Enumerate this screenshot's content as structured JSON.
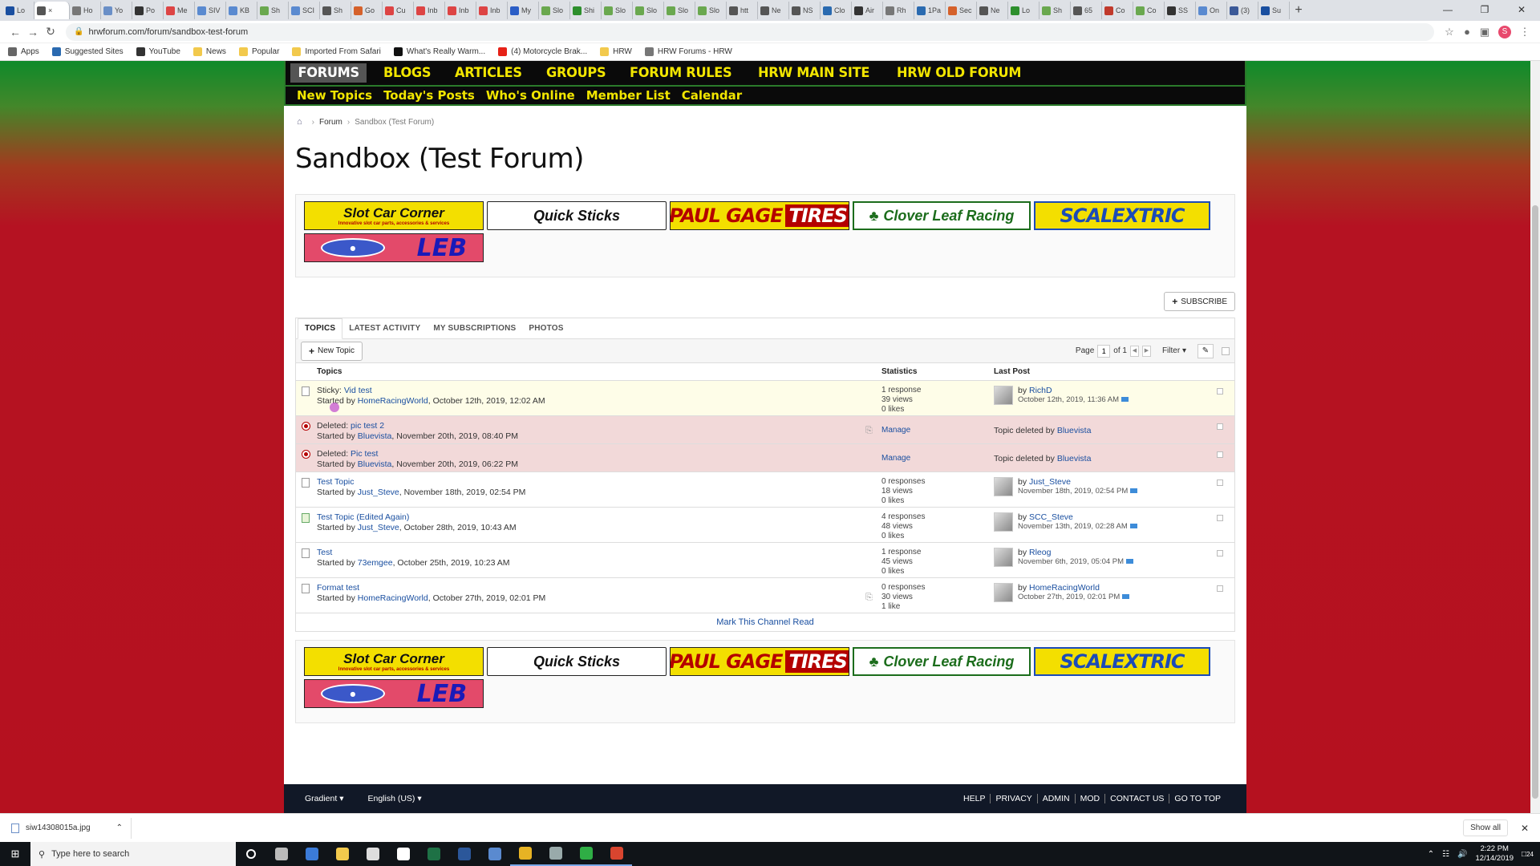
{
  "browser": {
    "tabs": [
      {
        "label": "Lo",
        "color": "#1a4fa0"
      },
      {
        "label": "",
        "color": "#555",
        "active": true
      },
      {
        "label": "Ho",
        "color": "#777"
      },
      {
        "label": "Yo",
        "color": "#6a8fc7"
      },
      {
        "label": "Po",
        "color": "#333"
      },
      {
        "label": "Me",
        "color": "#d44"
      },
      {
        "label": "SIV",
        "color": "#5a8ad0"
      },
      {
        "label": "KB",
        "color": "#5a8ad0"
      },
      {
        "label": "Sh",
        "color": "#6aa84f"
      },
      {
        "label": "SCI",
        "color": "#5a8ad0"
      },
      {
        "label": "Sh",
        "color": "#555"
      },
      {
        "label": "Go",
        "color": "#d5612b"
      },
      {
        "label": "Cu",
        "color": "#d44"
      },
      {
        "label": "Inb",
        "color": "#d44"
      },
      {
        "label": "Inb",
        "color": "#d44"
      },
      {
        "label": "Inb",
        "color": "#d44"
      },
      {
        "label": "My",
        "color": "#2a5dc6"
      },
      {
        "label": "Slo",
        "color": "#6aa84f"
      },
      {
        "label": "Shi",
        "color": "#2d8f2d"
      },
      {
        "label": "Slo",
        "color": "#6aa84f"
      },
      {
        "label": "Slo",
        "color": "#6aa84f"
      },
      {
        "label": "Slo",
        "color": "#6aa84f"
      },
      {
        "label": "Slo",
        "color": "#6aa84f"
      },
      {
        "label": "htt",
        "color": "#555"
      },
      {
        "label": "Ne",
        "color": "#555"
      },
      {
        "label": "NS",
        "color": "#555"
      },
      {
        "label": "Clo",
        "color": "#2a6ab0"
      },
      {
        "label": "Air",
        "color": "#333"
      },
      {
        "label": "Rh",
        "color": "#777"
      },
      {
        "label": "1Pa",
        "color": "#2a6ab0"
      },
      {
        "label": "Sec",
        "color": "#d5612b"
      },
      {
        "label": "Ne",
        "color": "#555"
      },
      {
        "label": "Lo",
        "color": "#2d8f2d"
      },
      {
        "label": "Sh",
        "color": "#6aa84f"
      },
      {
        "label": "65",
        "color": "#555"
      },
      {
        "label": "Co",
        "color": "#c0392b"
      },
      {
        "label": "Co",
        "color": "#6aa84f"
      },
      {
        "label": "SS",
        "color": "#333"
      },
      {
        "label": "On",
        "color": "#5a8ad0"
      },
      {
        "label": "(3)",
        "color": "#3b5998"
      },
      {
        "label": "Su",
        "color": "#1a4fa0"
      }
    ],
    "url": "hrwforum.com/forum/sandbox-test-forum",
    "bookmarks": [
      {
        "label": "Apps",
        "color": "#666"
      },
      {
        "label": "Suggested Sites",
        "color": "#2a6ab0"
      },
      {
        "label": "YouTube",
        "color": "#333"
      },
      {
        "label": "News",
        "color": "#f2c94c"
      },
      {
        "label": "Popular",
        "color": "#f2c94c"
      },
      {
        "label": "Imported From Safari",
        "color": "#f2c94c"
      },
      {
        "label": "What's Really Warm...",
        "color": "#111"
      },
      {
        "label": "(4) Motorcycle Brak...",
        "color": "#e62117"
      },
      {
        "label": "HRW",
        "color": "#f2c94c"
      },
      {
        "label": "HRW Forums - HRW",
        "color": "#777"
      }
    ]
  },
  "nav": {
    "main": [
      "FORUMS",
      "BLOGS",
      "ARTICLES",
      "GROUPS",
      "FORUM RULES",
      "HRW MAIN SITE",
      "HRW OLD FORUM"
    ],
    "sub": [
      "New Topics",
      "Today's Posts",
      "Who's Online",
      "Member List",
      "Calendar"
    ]
  },
  "breadcrumb": {
    "forum": "Forum",
    "current": "Sandbox (Test Forum)"
  },
  "page_title": "Sandbox (Test Forum)",
  "sponsors": {
    "slot_car": "Slot Car Corner",
    "slot_car_tag": "Innovative slot car parts, accessories & services",
    "quick_sticks": "Quick Sticks",
    "paul_gage": "PAUL GAGE",
    "paul_gage_tires": "TIRES",
    "clover": "Clover Leaf Racing",
    "scalextric": "SCALEXTRIC",
    "leb": "LEB"
  },
  "subscribe_label": "SUBSCRIBE",
  "tabs": [
    "TOPICS",
    "LATEST ACTIVITY",
    "MY SUBSCRIPTIONS",
    "PHOTOS"
  ],
  "new_topic_label": "New Topic",
  "pager": {
    "page_label": "Page",
    "page": "1",
    "of_label": "of 1"
  },
  "filter_label": "Filter",
  "columns": {
    "topics": "Topics",
    "statistics": "Statistics",
    "last_post": "Last Post"
  },
  "topics": [
    {
      "kind": "sticky",
      "prefix": "Sticky:",
      "title": "Vid test",
      "started_by": "HomeRacingWorld",
      "started_at": ", October 12th, 2019, 12:02 AM",
      "stats": [
        "1 response",
        "39 views",
        "0 likes"
      ],
      "last_by": "RichD",
      "last_at": "October 12th, 2019, 11:36 AM"
    },
    {
      "kind": "deleted",
      "prefix": "Deleted:",
      "title": "pic test 2",
      "started_by": "Bluevista",
      "started_at": ", November 20th, 2019, 08:40 PM",
      "manage": "Manage",
      "deleted_text": "Topic deleted by",
      "deleted_by": "Bluevista",
      "clip": true
    },
    {
      "kind": "deleted",
      "prefix": "Deleted:",
      "title": "Pic test",
      "started_by": "Bluevista",
      "started_at": ", November 20th, 2019, 06:22 PM",
      "manage": "Manage",
      "deleted_text": "Topic deleted by",
      "deleted_by": "Bluevista"
    },
    {
      "kind": "normal",
      "title": "Test Topic",
      "started_by": "Just_Steve",
      "started_at": ", November 18th, 2019, 02:54 PM",
      "stats": [
        "0 responses",
        "18 views",
        "0 likes"
      ],
      "last_by": "Just_Steve",
      "last_at": "November 18th, 2019, 02:54 PM"
    },
    {
      "kind": "photo",
      "title": "Test Topic (Edited Again)",
      "started_by": "Just_Steve",
      "started_at": ", October 28th, 2019, 10:43 AM",
      "stats": [
        "4 responses",
        "48 views",
        "0 likes"
      ],
      "last_by": "SCC_Steve",
      "last_at": "November 13th, 2019, 02:28 AM"
    },
    {
      "kind": "normal",
      "title": "Test",
      "started_by": "73emgee",
      "started_at": ", October 25th, 2019, 10:23 AM",
      "stats": [
        "1 response",
        "45 views",
        "0 likes"
      ],
      "last_by": "Rleog",
      "last_at": "November 6th, 2019, 05:04 PM"
    },
    {
      "kind": "normal",
      "title": "Format test",
      "started_by": "HomeRacingWorld",
      "started_at": ", October 27th, 2019, 02:01 PM",
      "stats": [
        "0 responses",
        "30 views",
        "1 like"
      ],
      "last_by": "HomeRacingWorld",
      "last_at": "October 27th, 2019, 02:01 PM",
      "clip": true
    }
  ],
  "started_by_label": "Started by",
  "by_label": "by",
  "mark_read": "Mark This Channel Read",
  "footer": {
    "style": "Gradient",
    "language": "English (US)",
    "links": [
      "HELP",
      "PRIVACY",
      "ADMIN",
      "MOD",
      "CONTACT US",
      "GO TO TOP"
    ]
  },
  "download": {
    "file": "siw14308015a.jpg",
    "show_all": "Show all"
  },
  "taskbar": {
    "search_placeholder": "Type here to search",
    "apps": [
      {
        "name": "cortana",
        "color": "#ffffff"
      },
      {
        "name": "task-view",
        "color": "#bbbbbb"
      },
      {
        "name": "edge",
        "color": "#3b7bd8"
      },
      {
        "name": "file-explorer",
        "color": "#f2c94c"
      },
      {
        "name": "store",
        "color": "#dddddd"
      },
      {
        "name": "mail",
        "color": "#ffffff"
      },
      {
        "name": "excel",
        "color": "#1e7145"
      },
      {
        "name": "word",
        "color": "#2b579a"
      },
      {
        "name": "app-blue",
        "color": "#5a8ad0"
      },
      {
        "name": "chrome",
        "color": "#e7b324"
      },
      {
        "name": "app-grey",
        "color": "#9aa"
      },
      {
        "name": "camtasia-green",
        "color": "#2fae45"
      },
      {
        "name": "camtasia-red",
        "color": "#d8452f"
      }
    ],
    "time": "2:22 PM",
    "date": "12/14/2019",
    "notifications": "24"
  }
}
